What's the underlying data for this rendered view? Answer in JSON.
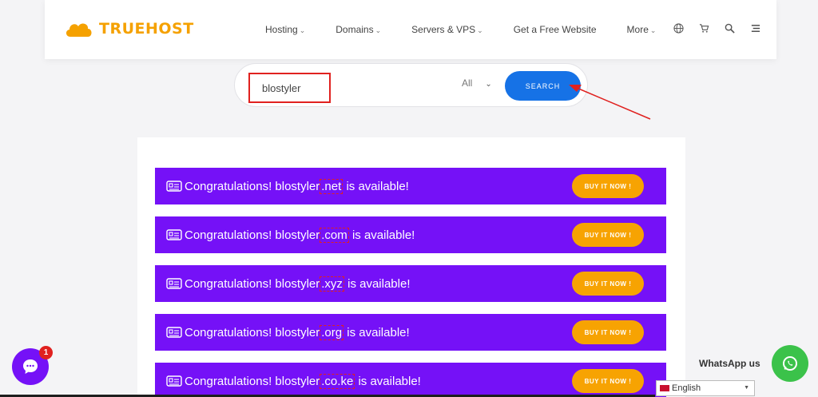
{
  "header": {
    "logo_text": "TRUEHOST",
    "brand_color": "#f5a100",
    "nav": [
      {
        "label": "Hosting",
        "has_dropdown": true
      },
      {
        "label": "Domains",
        "has_dropdown": true
      },
      {
        "label": "Servers & VPS",
        "has_dropdown": true
      },
      {
        "label": "Get a Free Website",
        "has_dropdown": false
      },
      {
        "label": "More",
        "has_dropdown": true
      }
    ],
    "icons": [
      "globe-icon",
      "cart-icon",
      "search-icon",
      "menu-icon"
    ]
  },
  "search": {
    "value": "blostyler",
    "tld_filter": "All",
    "button_label": "SEARCH",
    "button_color": "#1672e6"
  },
  "results": {
    "row_color": "#7511f7",
    "buy_color": "#f7a302",
    "rows": [
      {
        "prefix": "Congratulations! blostyler",
        "tld": ".net",
        "suffix": " is available!",
        "button": "BUY IT NOW !"
      },
      {
        "prefix": "Congratulations! blostyler",
        "tld": ".com",
        "suffix": " is available!",
        "button": "BUY IT NOW !"
      },
      {
        "prefix": "Congratulations! blostyler",
        "tld": ".xyz",
        "suffix": " is available!",
        "button": "BUY IT NOW !"
      },
      {
        "prefix": "Congratulations! blostyler",
        "tld": ".org",
        "suffix": " is available!",
        "button": "BUY IT NOW !"
      },
      {
        "prefix": "Congratulations! blostyler",
        "tld": ".co.ke",
        "suffix": " is available!",
        "button": "BUY IT NOW !"
      }
    ]
  },
  "chat": {
    "badge_count": "1"
  },
  "whatsapp": {
    "label": "WhatsApp us"
  },
  "language": {
    "selected": "English"
  }
}
